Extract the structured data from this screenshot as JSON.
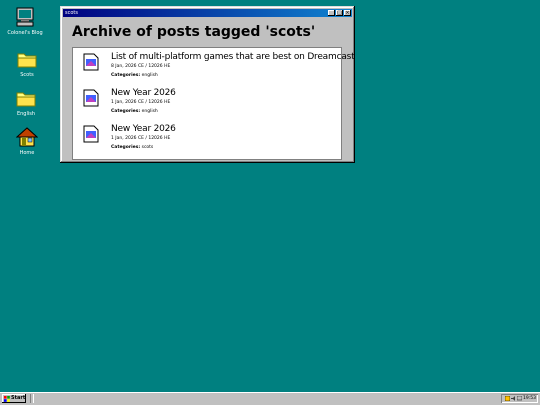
{
  "desktop": {
    "icons": [
      {
        "label": "Colonel's Blog",
        "icon": "computer-icon"
      },
      {
        "label": "Scots",
        "icon": "folder-icon"
      },
      {
        "label": "English",
        "icon": "folder-icon"
      },
      {
        "label": "Home",
        "icon": "home-icon"
      }
    ]
  },
  "window": {
    "title": "scots",
    "heading": "Archive of posts tagged 'scots'",
    "buttons": {
      "minimize": "_",
      "maximize": "□",
      "close": "×"
    },
    "posts": [
      {
        "title": "List of multi-platform games that are best on Dreamcast",
        "date": "8 Jan, 2026 CE / 12026 HE",
        "categories_label": "Categories:",
        "categories": "english"
      },
      {
        "title": "New Year 2026",
        "date": "1 Jan, 2026 CE / 12026 HE",
        "categories_label": "Categories:",
        "categories": "english"
      },
      {
        "title": "New Year 2026",
        "date": "1 Jan, 2026 CE / 12026 HE",
        "categories_label": "Categories:",
        "categories": "scots"
      }
    ]
  },
  "taskbar": {
    "start_label": "Start",
    "clock": "19:53"
  },
  "colors": {
    "desktop": "#008080",
    "titlebar_start": "#000080",
    "titlebar_end": "#1084d0",
    "chrome": "#c0c0c0"
  }
}
